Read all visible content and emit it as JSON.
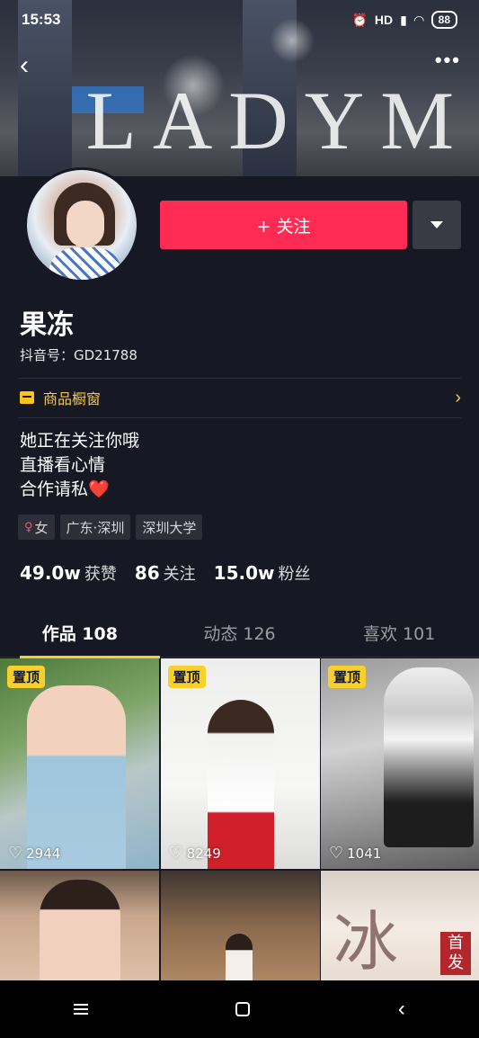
{
  "status_bar": {
    "time": "15:53",
    "network": "HD",
    "battery": "88"
  },
  "header": {
    "back_icon": "chevron-left-icon",
    "more_icon": "more-dots-icon",
    "cover_text": "LADYM"
  },
  "profile": {
    "follow_label": "+ 关注",
    "nickname": "果冻",
    "douyin_id": "抖音号：GD21788",
    "shop_label": "商品橱窗",
    "bio_lines": [
      "她正在关注你哦",
      "直播看心情",
      "合作请私"
    ],
    "bio_heart": "❤️",
    "tags": {
      "gender": "女",
      "location": "广东·深圳",
      "school": "深圳大学"
    },
    "stats": {
      "likes_num": "49.0w",
      "likes_label": "获赞",
      "following_num": "86",
      "following_label": "关注",
      "followers_num": "15.0w",
      "followers_label": "粉丝"
    }
  },
  "tabs": [
    {
      "label": "作品 108",
      "active": true
    },
    {
      "label": "动态 126",
      "active": false
    },
    {
      "label": "喜欢 101",
      "active": false
    }
  ],
  "videos": [
    {
      "pinned_label": "置顶",
      "likes": "2944"
    },
    {
      "pinned_label": "置顶",
      "likes": "8249"
    },
    {
      "pinned_label": "置顶",
      "likes": "1041"
    }
  ],
  "watermark": {
    "text": "首发",
    "big_char": "冰"
  },
  "colors": {
    "follow": "#fe2c55",
    "accent_yellow": "#f8c844",
    "background": "#161823"
  }
}
